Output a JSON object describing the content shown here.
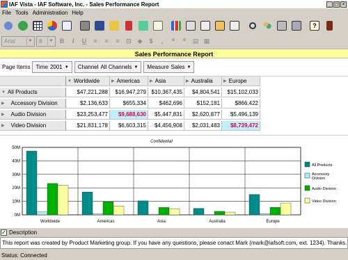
{
  "window": {
    "title": "IAF Vista - IAF Software, Inc. - Sales Performance Report",
    "minimize": "_",
    "maximize": "□",
    "close": "×"
  },
  "menu": [
    "File",
    "Tools",
    "Administration",
    "Help"
  ],
  "toolbar": {
    "icons": [
      "back-icon",
      "refresh-icon",
      "table-icon",
      "pie-chart-icon",
      "table-chart-icon",
      "print-icon",
      "save-icon",
      "open-icon",
      "query-icon",
      "chart-wizard-icon",
      "notes-icon",
      "chart-icon",
      "export-icon",
      "copy-icon",
      "paste-icon",
      "copy2-icon",
      "search-icon",
      "users-icon",
      "printer-icon",
      "layout-icon",
      "help-icon",
      "exit-icon"
    ]
  },
  "format_bar": {
    "font": "Arial",
    "size": "8",
    "bold": "B",
    "italic": "I",
    "underline": "U"
  },
  "report": {
    "title": "Sales Performance Report"
  },
  "page_items": {
    "label": "Page Items",
    "time": {
      "name": "Time",
      "value": "2001"
    },
    "channel": {
      "name": "Channel",
      "value": "All Channels"
    },
    "measure": {
      "name": "Measure",
      "value": "Sales"
    }
  },
  "table": {
    "columns": [
      "Worldwide",
      "Americas",
      "Asia",
      "Australia",
      "Europe"
    ],
    "rows": [
      {
        "label": "All Products",
        "values": [
          "$47,221,288",
          "$16,947,279",
          "$10,367,435",
          "$4,804,541",
          "$15,102,033"
        ]
      },
      {
        "label": "Accessory Division",
        "values": [
          "$2,136,633",
          "$655,334",
          "$462,696",
          "$152,181",
          "$866,422"
        ]
      },
      {
        "label": "Audio Division",
        "values": [
          "$23,253,477",
          "$9,688,630",
          "$5,447,831",
          "$2,620,877",
          "$5,496,139"
        ]
      },
      {
        "label": "Video Division",
        "values": [
          "$21,831,178",
          "$6,603,315",
          "$4,456,908",
          "$2,031,483",
          "$8,739,472"
        ]
      }
    ]
  },
  "chart_data": {
    "type": "bar",
    "title": "Confidential",
    "categories": [
      "Worldwide",
      "Americas",
      "Asia",
      "Australia",
      "Europe"
    ],
    "ylim": [
      0,
      50
    ],
    "yticks": [
      "0M",
      "10M",
      "20M",
      "30M",
      "40M",
      "50M"
    ],
    "series": [
      {
        "name": "All Products",
        "color": "#008b8b",
        "values": [
          47.22,
          16.95,
          10.37,
          4.8,
          15.1
        ]
      },
      {
        "name": "Accessory Division",
        "color": "#aeeeee",
        "values": [
          2.14,
          0.66,
          0.46,
          0.15,
          0.87
        ]
      },
      {
        "name": "Audio Division",
        "color": "#00b000",
        "values": [
          23.25,
          9.69,
          5.45,
          2.62,
          5.5
        ]
      },
      {
        "name": "Video Division",
        "color": "#ffffa0",
        "values": [
          21.83,
          6.6,
          4.46,
          2.03,
          8.74
        ]
      }
    ]
  },
  "description": {
    "checkbox_label": "Description",
    "checked": true,
    "text": "This report was created by Product Marketing group. If you have any questions, please conact Mark (mark@iafsoft.com, ext. 1234). Thanks."
  },
  "status": "Status: Connected"
}
